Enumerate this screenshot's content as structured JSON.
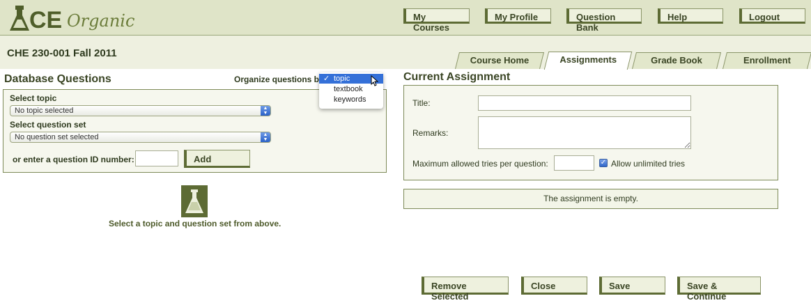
{
  "app": {
    "logo_text": "ACE Organic",
    "nav": [
      "My Courses",
      "My Profile",
      "Question Bank",
      "Help",
      "Logout"
    ]
  },
  "course": {
    "title": "CHE 230-001 Fall 2011"
  },
  "tabs": [
    "Course Home",
    "Assignments",
    "Grade Book",
    "Enrollment"
  ],
  "active_tab": "Assignments",
  "database": {
    "heading": "Database Questions",
    "organize_label": "Organize questions by",
    "organize_options": [
      "topic",
      "textbook",
      "keywords"
    ],
    "organize_selected": "topic",
    "select_topic_label": "Select topic",
    "topic_value": "No topic selected",
    "select_set_label": "Select question set",
    "set_value": "No question set selected",
    "id_label": "or enter a question ID number:",
    "id_value": "",
    "add_label": "Add",
    "hint": "Select a topic and question set from above."
  },
  "assignment": {
    "heading": "Current Assignment",
    "title_label": "Title:",
    "title_value": "",
    "remarks_label": "Remarks:",
    "remarks_value": "",
    "max_tries_label": "Maximum allowed tries per question:",
    "max_tries_value": "",
    "unlimited_label": "Allow unlimited tries",
    "unlimited_checked": true,
    "empty_message": "The assignment is empty."
  },
  "actions": [
    "Remove Selected",
    "Close",
    "Save",
    "Save & Continue"
  ],
  "colors": {
    "olive_dark": "#5d6b34",
    "header_bg": "#dfe4c8",
    "select_blue": "#3470d8"
  }
}
